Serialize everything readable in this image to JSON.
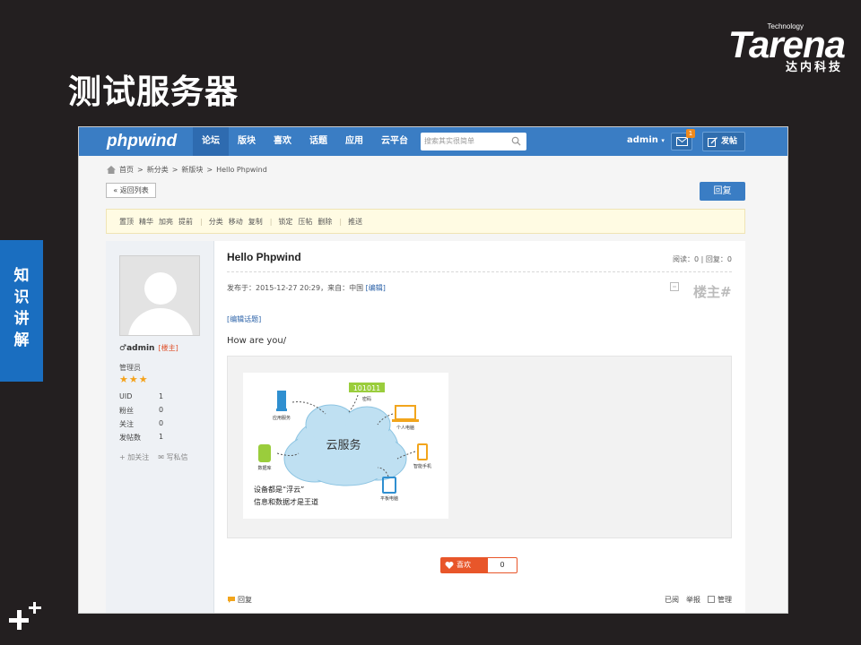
{
  "slide": {
    "brand": {
      "tech": "Technology",
      "name": "Tarena",
      "cn": "达内科技"
    },
    "title": "测试服务器",
    "side_tab": [
      "知",
      "识",
      "讲",
      "解"
    ]
  },
  "topbar": {
    "logo": "phpwind",
    "nav": [
      "论坛",
      "版块",
      "喜欢",
      "话题",
      "应用",
      "云平台"
    ],
    "search_placeholder": "搜索其实很简单",
    "user": "admin",
    "message_count": "1",
    "post_label": "发帖",
    "colors": {
      "bar": "#3a7dc4",
      "active": "#2e6bb0"
    }
  },
  "breadcrumb": [
    "首页",
    "新分类",
    "新版块",
    "Hello Phpwind"
  ],
  "buttons": {
    "back": "« 返回列表",
    "reply": "回复"
  },
  "toolbar": {
    "groups": [
      [
        "置顶",
        "精华",
        "加亮",
        "提前"
      ],
      [
        "分类",
        "移动",
        "复制"
      ],
      [
        "锁定",
        "压帖",
        "删除"
      ],
      [
        "推送"
      ]
    ]
  },
  "author": {
    "name": "admin",
    "badge": "[楼主]",
    "role": "管理员",
    "stars": "★★★",
    "stats": [
      {
        "k": "UID",
        "v": "1"
      },
      {
        "k": "粉丝",
        "v": "0"
      },
      {
        "k": "关注",
        "v": "0"
      },
      {
        "k": "发帖数",
        "v": "1"
      }
    ],
    "follow": "+ 加关注",
    "message": "写私信"
  },
  "post": {
    "title": "Hello Phpwind",
    "read_label": "阅读：",
    "read_count": "0",
    "reply_label": "回复：",
    "reply_count": "0",
    "time": "发布于：2015-12-27 20:29，来自：中国",
    "source": "[编辑]",
    "floor": "楼主#",
    "edit_link": "[编辑话题]",
    "content": "How are you/"
  },
  "cloud_image": {
    "center": "云服务",
    "code": "101011",
    "labels": [
      "密码",
      "应用服务",
      "个人电脑",
      "数据库",
      "智能手机",
      "平板电脑"
    ],
    "caption1": "设备都是“浮云”",
    "caption2": "信息和数据才是王道"
  },
  "actions": {
    "like": "喜欢",
    "like_count": "0",
    "reply": "回复",
    "read": "已阅",
    "report": "举报",
    "manage": "管理"
  }
}
